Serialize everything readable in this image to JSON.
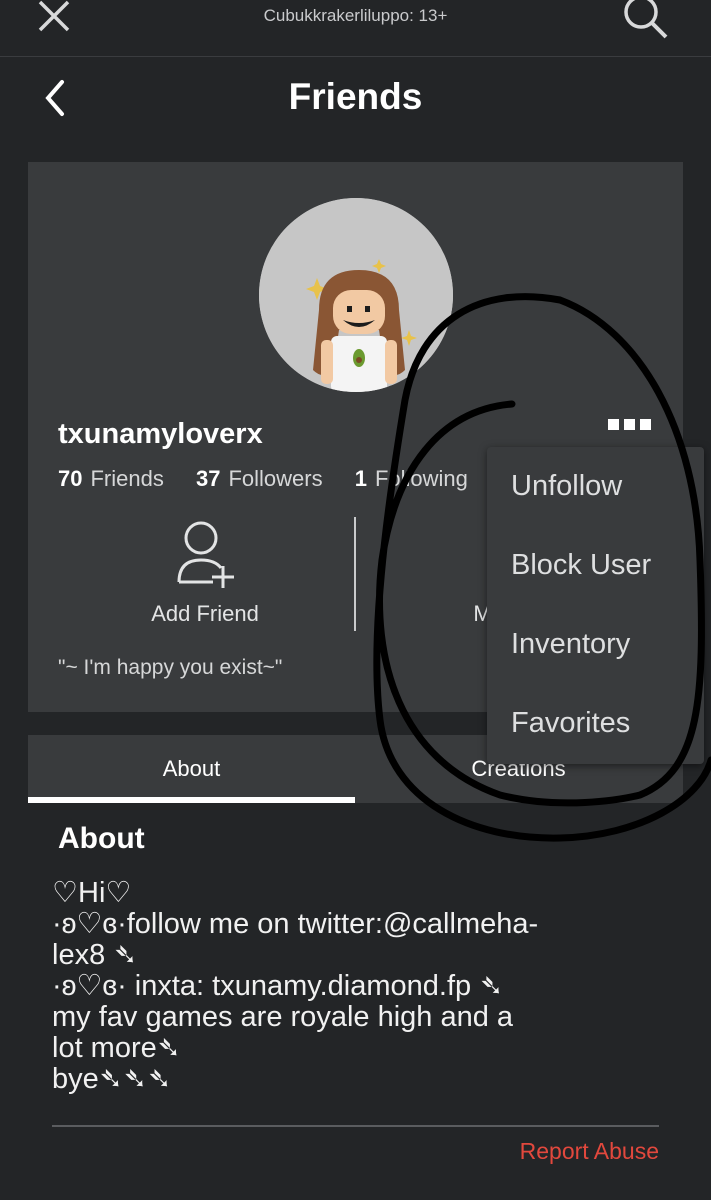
{
  "topbar": {
    "title": "Cubukkrakerliluppo: 13+",
    "close_icon": "close-icon",
    "search_icon": "search-icon"
  },
  "header": {
    "title": "Friends",
    "back_icon": "chevron-left-icon"
  },
  "profile": {
    "username": "txunamyloverx",
    "stats": [
      {
        "count": "70",
        "label": "Friends"
      },
      {
        "count": "37",
        "label": "Followers"
      },
      {
        "count": "1",
        "label": "Following"
      }
    ],
    "actions": [
      {
        "label": "Add Friend",
        "icon": "add-friend-icon"
      },
      {
        "label": "Message",
        "icon": "message-icon"
      }
    ],
    "status": "\"~ I'm happy you exist~\""
  },
  "menu": {
    "items": [
      "Unfollow",
      "Block User",
      "Inventory",
      "Favorites"
    ]
  },
  "tabs": [
    {
      "label": "About",
      "active": true
    },
    {
      "label": "Creations",
      "active": false
    }
  ],
  "about": {
    "title": "About",
    "body": "♡Hi♡\n·ʚ♡ɞ·follow me on twitter:@callmeha-\nlex8 ➴\n·ʚ♡ɞ· inxta: txunamy.diamond.fp ➴\nmy fav games are royale high and a\nlot more➴\nbye➴➴➴"
  },
  "footer": {
    "report": "Report Abuse"
  },
  "colors": {
    "background": "#232527",
    "card": "#393b3d",
    "report": "#e2483d"
  }
}
